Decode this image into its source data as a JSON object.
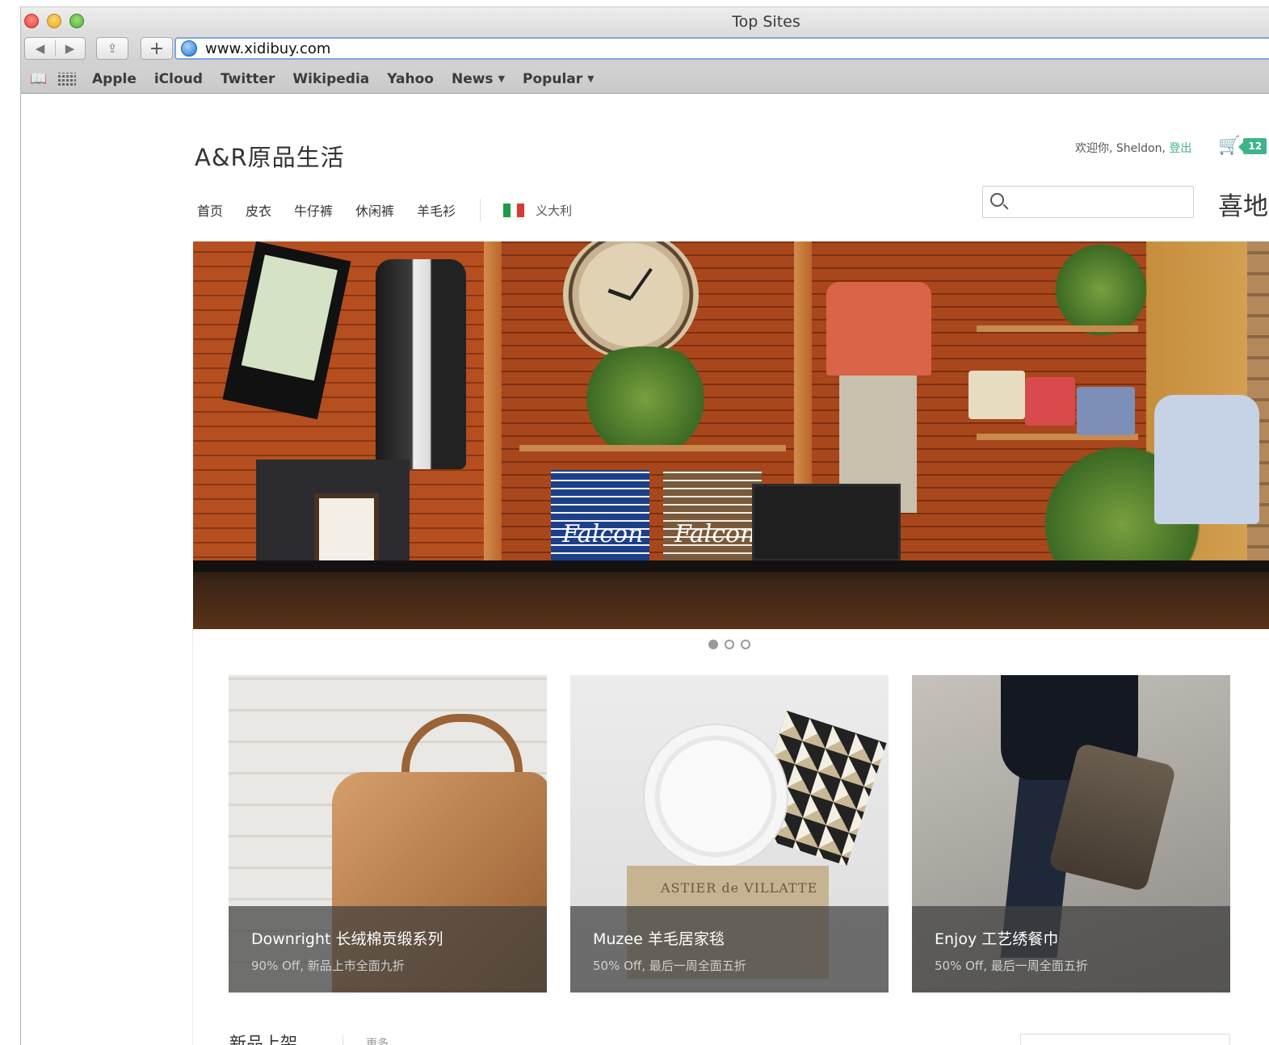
{
  "window": {
    "title": "Top Sites"
  },
  "toolbar": {
    "url": "www.xidibuy.com",
    "new_tab": "+"
  },
  "bookmarks": {
    "items": [
      {
        "label": "Apple"
      },
      {
        "label": "iCloud"
      },
      {
        "label": "Twitter"
      },
      {
        "label": "Wikipedia"
      },
      {
        "label": "Yahoo"
      },
      {
        "label": "News",
        "has_menu": true
      },
      {
        "label": "Popular",
        "has_menu": true
      }
    ]
  },
  "site": {
    "brand": "A&R原品生活",
    "welcome_prefix": "欢迎你, Sheldon,",
    "logout": "登出",
    "cart_count": "12",
    "accent_color": "#3fb48a",
    "nav": [
      "首页",
      "皮衣",
      "牛仔裤",
      "休闲裤",
      "羊毛衫"
    ],
    "country": "义大利",
    "search_placeholder": "",
    "side_text": "喜地"
  },
  "hero": {
    "slides": 3,
    "active_slide": 1,
    "towel_text": "Falcon"
  },
  "cards": [
    {
      "title": "Downright 长绒棉贡缎系列",
      "subtitle": "90% Off, 新品上市全面九折"
    },
    {
      "title": "Muzee 羊毛居家毯",
      "subtitle": "50% Off, 最后一周全面五折",
      "box_label": "ASTIER de VILLATTE"
    },
    {
      "title": "Enjoy 工艺绣餐巾",
      "subtitle": "50% Off, 最后一周全面五折"
    }
  ],
  "section": {
    "title": "新品上架",
    "more": "更多"
  }
}
